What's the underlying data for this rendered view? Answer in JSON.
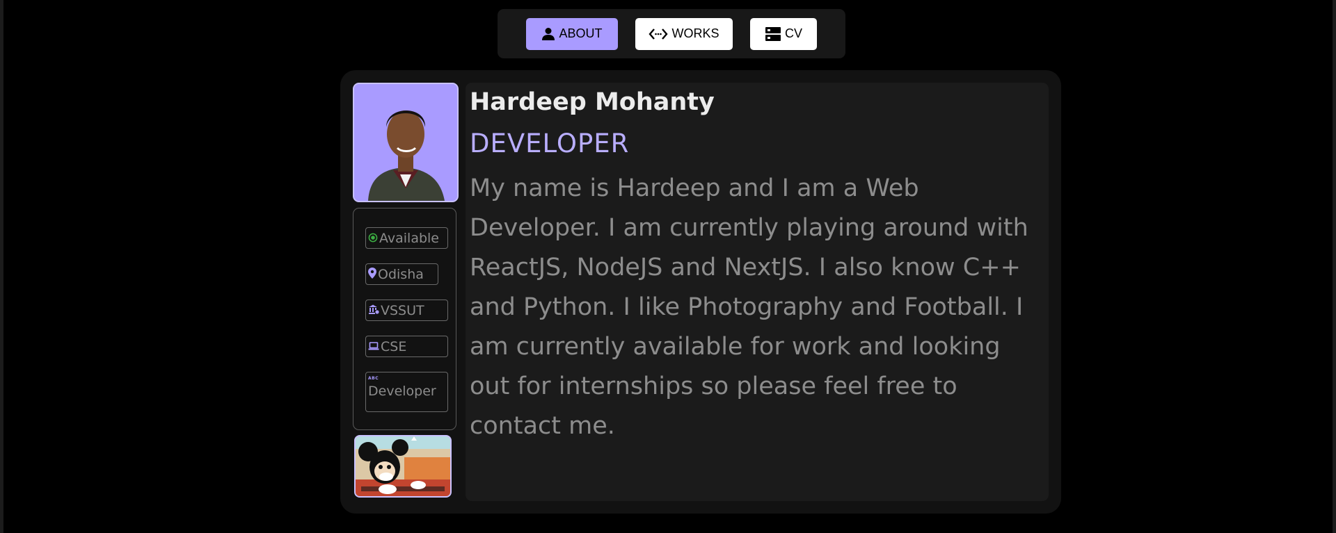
{
  "nav": {
    "items": [
      {
        "label": "ABOUT",
        "icon": "person-icon",
        "active": true
      },
      {
        "label": "WORKS",
        "icon": "code-icon",
        "active": false
      },
      {
        "label": "CV",
        "icon": "server-icon",
        "active": false
      }
    ]
  },
  "profile": {
    "name": "Hardeep Mohanty",
    "role": "DEVELOPER",
    "bio": "My name is Hardeep and I am a Web Developer. I am currently playing around with ReactJS, NodeJS and NextJS. I also know C++ and Python. I like Photography and Football. I am currently available for work and looking out for internships so please feel free to contact me."
  },
  "tags": [
    {
      "label": "Available",
      "icon": "available-dot-icon"
    },
    {
      "label": "Odisha",
      "icon": "location-pin-icon"
    },
    {
      "label": "VSSUT",
      "icon": "institution-icon"
    },
    {
      "label": "CSE",
      "icon": "laptop-icon"
    },
    {
      "label": "Developer",
      "icon": "abc-icon",
      "icon_text": "ABC"
    }
  ],
  "colors": {
    "accent": "#a99bff",
    "accent_text": "#b9aeff",
    "available": "#3cb043",
    "background": "#000000",
    "card": "#121212",
    "panel": "#1b1b1b"
  }
}
